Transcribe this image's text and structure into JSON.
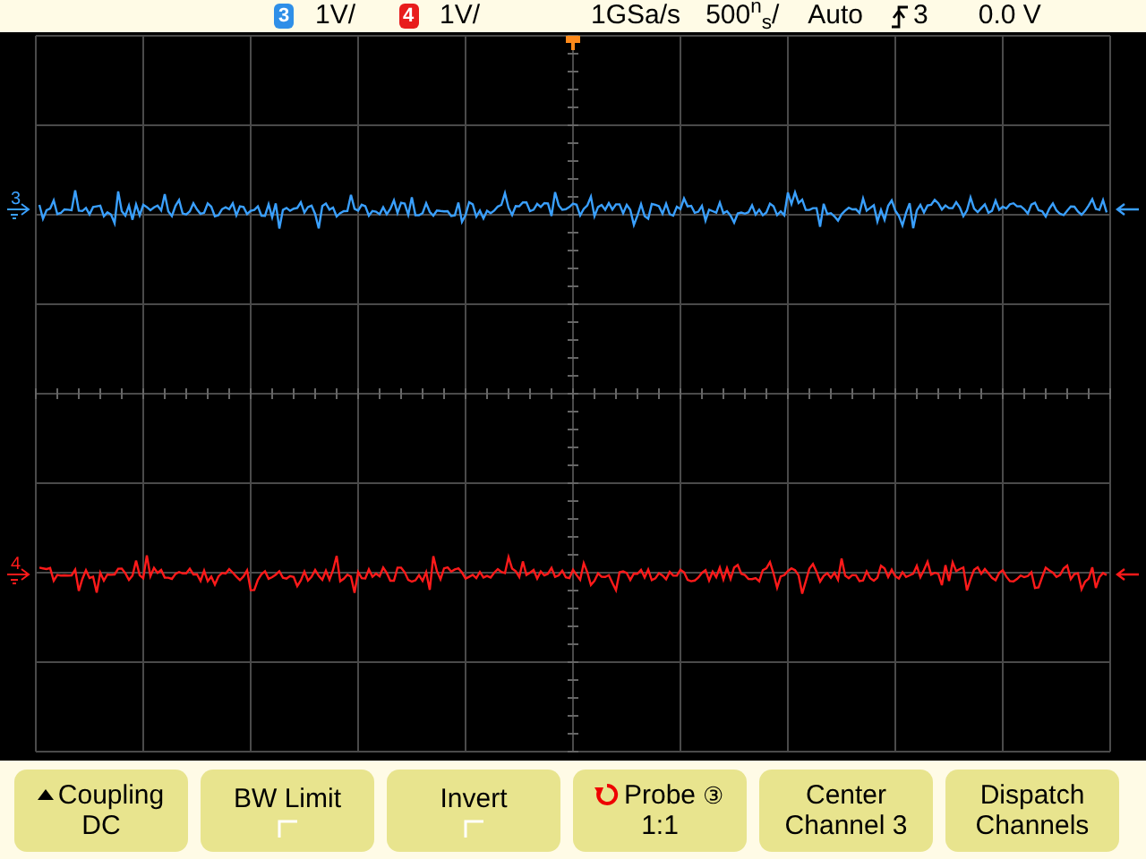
{
  "status_bar": {
    "channels": [
      {
        "number": "3",
        "scale": "1V/",
        "color": "#2f8fe8"
      },
      {
        "number": "4",
        "scale": "1V/",
        "color": "#e81c1c"
      }
    ],
    "sample_rate": "1GSa/s",
    "timebase": "500$^{n}$$_{s}$/",
    "trigger_mode": "Auto",
    "trigger_source": "3",
    "trigger_level": "0.0 V"
  },
  "traces": [
    {
      "label": "3",
      "color": "#3aa0ff"
    },
    {
      "label": "4",
      "color": "#ff1a1a"
    }
  ],
  "softkeys": [
    {
      "kind": "menu",
      "label": "Coupling",
      "value": "DC"
    },
    {
      "kind": "toggle",
      "label": "BW Limit",
      "checked": false
    },
    {
      "kind": "toggle",
      "label": "Invert",
      "checked": false
    },
    {
      "kind": "knob",
      "label": "Probe",
      "badge": "③",
      "value": "1:1"
    },
    {
      "kind": "plain",
      "label": "Center",
      "value": "Channel 3"
    },
    {
      "kind": "plain",
      "label": "Dispatch",
      "value": "Channels"
    }
  ]
}
